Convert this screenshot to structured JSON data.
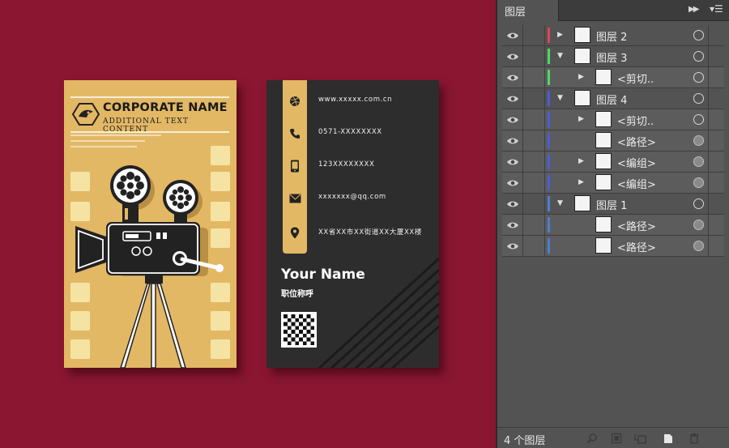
{
  "canvas": {
    "background": "#8a1631"
  },
  "front_card": {
    "background": "#e3b865",
    "accent": "#f2da98",
    "dark": "#222222",
    "corporate_name": "CORPORATE NAME",
    "additional_text": "ADDITIONAL TEXT CONTENT"
  },
  "back_card": {
    "background": "#2d2d2d",
    "accent": "#e3b865",
    "contacts": [
      {
        "icon": "dribbble-icon",
        "text": "www.xxxxx.com.cn"
      },
      {
        "icon": "phone-icon",
        "text": "0571-XXXXXXXX"
      },
      {
        "icon": "mobile-icon",
        "text": "123XXXXXXXX"
      },
      {
        "icon": "mail-icon",
        "text": "xxxxxxx@qq.com"
      },
      {
        "icon": "location-icon",
        "text": "XX省XX市XX街道XX大厦XX楼"
      }
    ],
    "your_name": "Your Name",
    "job_title": "职位称呼"
  },
  "layers_panel": {
    "tab_label": "图层",
    "collapse_icon": "double-chevron-right-icon",
    "menu_icon": "panel-menu-icon",
    "layers": [
      {
        "label": "图层 2",
        "level": 0,
        "expander": "collapsed",
        "color": "#e0464e",
        "target_filled": false
      },
      {
        "label": "图层 3",
        "level": 0,
        "expander": "expanded",
        "color": "#4cd964",
        "target_filled": false
      },
      {
        "label": "<剪切..",
        "level": 1,
        "expander": "collapsed",
        "color": "#4cd964",
        "target_filled": false
      },
      {
        "label": "图层 4",
        "level": 0,
        "expander": "expanded",
        "color": "#4a5bd6",
        "target_filled": false
      },
      {
        "label": "<剪切..",
        "level": 1,
        "expander": "collapsed",
        "color": "#4a5bd6",
        "target_filled": false
      },
      {
        "label": "<路径>",
        "level": 1,
        "expander": "none",
        "color": "#4a5bd6",
        "target_filled": true
      },
      {
        "label": "<编组>",
        "level": 1,
        "expander": "collapsed",
        "color": "#4a5bd6",
        "target_filled": true
      },
      {
        "label": "<编组>",
        "level": 1,
        "expander": "collapsed",
        "color": "#4a5bd6",
        "target_filled": true
      },
      {
        "label": "图层 1",
        "level": 0,
        "expander": "expanded",
        "color": "#4a7fd6",
        "target_filled": false
      },
      {
        "label": "<路径>",
        "level": 1,
        "expander": "none",
        "color": "#4a7fd6",
        "target_filled": true
      },
      {
        "label": "<路径>",
        "level": 1,
        "expander": "none",
        "color": "#4a7fd6",
        "target_filled": true
      }
    ],
    "layer_count": "4 个图层",
    "footer_icons": [
      "locate-object-icon",
      "make-clipping-mask-icon",
      "new-sublayer-icon",
      "new-layer-icon",
      "delete-icon"
    ]
  }
}
